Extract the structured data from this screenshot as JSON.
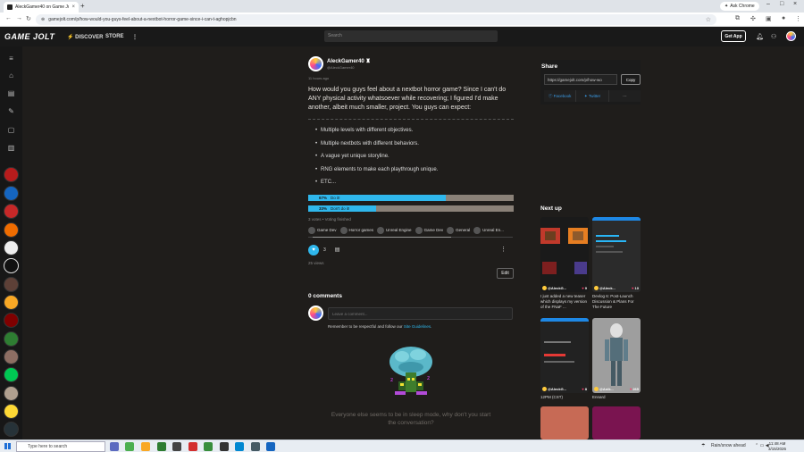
{
  "browser": {
    "tab_title": "AleckGamer40 on Game Jolt",
    "new_tab": "+",
    "ask_chrome": "Ask Chrome",
    "url": "gamejolt.com/p/how-would-you-guys-feel-about-a-nextbot-horror-game-since-i-can-t-aghopjcbn"
  },
  "site": {
    "logo": "GAME JOLT",
    "nav": [
      "DISCOVER",
      "STORE"
    ],
    "search_placeholder": "Search",
    "get_app": "Get App"
  },
  "post": {
    "author": "AleckGamer40",
    "handle": "@AleckGamer40",
    "time": "11 hours ago",
    "lead": "How would you guys feel about a nextbot horror game? Since I can't do ANY physical activity whatsoever while recovering; I figured I'd make another, albeit much smaller, project. You guys can expect:",
    "bullets": [
      "Multiple levels with different objectives.",
      "Multiple nextbots with different behaviors.",
      "A vague yet unique storyline.",
      "RNG elements to make each playthrough unique.",
      "ETC..."
    ],
    "poll": [
      {
        "percent_label": "67%",
        "label": "Do it!",
        "fraction": 0.67
      },
      {
        "percent_label": "33%",
        "label": "Don't do it!",
        "fraction": 0.33
      }
    ],
    "poll_meta": "3 votes  •  Voting finished",
    "tags": [
      "Game Dev",
      "Horror games",
      "Unreal Engine",
      "Game Dev",
      "General",
      "Unreal En..."
    ],
    "likes": "3",
    "views": "25 views",
    "edit": "Edit"
  },
  "comments": {
    "heading": "0 comments",
    "placeholder": "Leave a comment...",
    "guideline_prefix": "Remember to be respectful and follow our",
    "guideline_link": "Site Guidelines",
    "empty": "Everyone else seems to be in sleep mode, why don't you start the conversation?"
  },
  "share": {
    "title": "Share",
    "url": "https://gamejolt.com/p/how-wo",
    "copy": "Copy",
    "buttons": [
      "Facebook",
      "Twitter",
      "⋯"
    ]
  },
  "next_up": {
    "title": "Next up",
    "cards": [
      {
        "user": "@AleckG...",
        "likes": "9",
        "caption": "I just added a new teaser which displays my version of the FNaF ..."
      },
      {
        "user": "@Aleck...",
        "likes": "10",
        "caption": "Devlog 6: Post-Launch Discussion & Plans For The Future"
      },
      {
        "user": "@AleckG...",
        "likes": "8",
        "caption": "12PM (CST)"
      },
      {
        "user": "@Anik...",
        "likes": "265",
        "caption": "Ennard"
      }
    ]
  },
  "taskbar": {
    "search": "Type here to search",
    "weather": "Rain/snow ahead",
    "time": "11:48 AM",
    "date": "3/15/2026"
  },
  "colors": {
    "accent": "#2fb7ec",
    "page_bg": "#1f1d1b",
    "header_bg": "#191919",
    "like_red": "#ff3b6b"
  }
}
